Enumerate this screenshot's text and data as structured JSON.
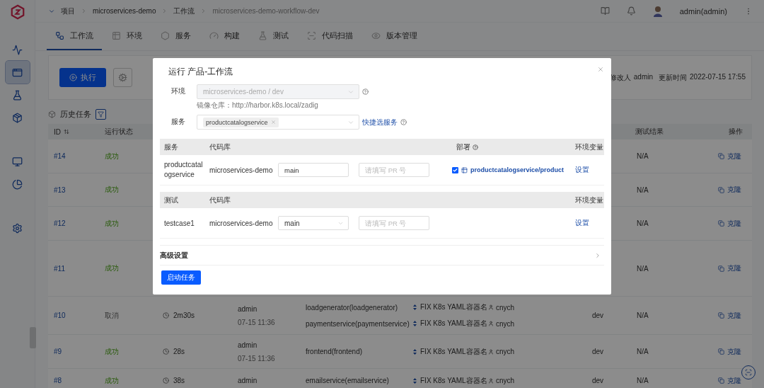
{
  "sidebar": {
    "items": [
      {
        "selected": false
      },
      {
        "selected": true
      },
      {
        "selected": false
      },
      {
        "selected": false
      },
      {
        "selected": false
      },
      {
        "selected": false
      },
      {
        "selected": false
      }
    ]
  },
  "breadcrumb": [
    "项目",
    "microservices-demo",
    "工作流",
    "microservices-demo-workflow-dev"
  ],
  "user": {
    "name": "admin(admin)"
  },
  "tabs": [
    {
      "label": "工作流",
      "selected": true
    },
    {
      "label": "环境",
      "selected": false
    },
    {
      "label": "服务",
      "selected": false
    },
    {
      "label": "构建",
      "selected": false
    },
    {
      "label": "测试",
      "selected": false
    },
    {
      "label": "代码扫描",
      "selected": false
    },
    {
      "label": "版本管理",
      "selected": false
    }
  ],
  "toolbar": {
    "run_button": "执行",
    "modified_by_label": "修改人",
    "modified_by": "admin",
    "updated_label": "更新时间",
    "updated": "2022-07-15 17:55"
  },
  "history": {
    "title": "历史任务"
  },
  "table": {
    "columns": {
      "id": "ID",
      "status": "运行状态",
      "test_result": "测试结果",
      "actions": "操作"
    },
    "rows": [
      {
        "id": "#14",
        "status": "成功",
        "kind": "success",
        "test_result": "N/A",
        "action": "克隆"
      },
      {
        "id": "#13",
        "status": "成功",
        "kind": "success",
        "test_result": "N/A",
        "action": "克隆"
      },
      {
        "id": "#12",
        "status": "成功",
        "kind": "success",
        "test_result": "N/A",
        "action": "克隆"
      },
      {
        "id": "#11",
        "status": "成功",
        "kind": "success",
        "test_result": "N/A",
        "action": "克隆"
      },
      {
        "id": "#10",
        "status": "取消",
        "kind": "cancelled",
        "duration": "2m30s",
        "creator": "admin",
        "time": "07-15 11:36",
        "services": [
          {
            "name": "loadgenerator(loadgenerator)",
            "commit": "FIX K8s YAML容器名",
            "author": "cnych"
          },
          {
            "name": "paymentservice(paymentservice)",
            "commit": "FIX K8s YAML容器名",
            "author": "cnych"
          }
        ],
        "env": "dev",
        "test_result": "N/A",
        "action": "克隆"
      },
      {
        "id": "#9",
        "status": "成功",
        "kind": "success",
        "duration": "28s",
        "creator": "admin",
        "time": "07-15 11:36",
        "services": [
          {
            "name": "frontend(frontend)",
            "commit": "FIX K8s YAML容器名",
            "author": "cnych"
          }
        ],
        "env": "dev",
        "test_result": "N/A",
        "action": "克隆"
      },
      {
        "id": "#8",
        "status": "成功",
        "kind": "success",
        "duration": "38s",
        "creator": "admin",
        "services": [
          {
            "name": "emailservice(emailservice)",
            "commit": "FIX K8s YAML容器名",
            "author": "cnych"
          }
        ],
        "env": "dev",
        "test_result": "N/A",
        "action": "克隆"
      }
    ]
  },
  "modal": {
    "title": "运行 产品-工作流",
    "env": {
      "label": "环境",
      "value": "microservices-demo / dev",
      "disabled": true,
      "hint": "镜像仓库：http://harbor.k8s.local/zadig"
    },
    "service": {
      "label": "服务",
      "tags": [
        "productcatalogservice"
      ],
      "link": "快捷选服务"
    },
    "build_table": {
      "columns": {
        "service": "服务",
        "repo": "代码库",
        "deploy": "部署",
        "env_vars": "环境变量"
      },
      "rows": [
        {
          "service": "productcatalogservice",
          "repo": "microservices-demo",
          "branch": "main",
          "pr_placeholder": "请填写 PR 号",
          "deploy_checked": true,
          "deploy_target": "productcatalogservice/product",
          "env_vars": "设置"
        }
      ]
    },
    "test_table": {
      "columns": {
        "test": "测试",
        "repo": "代码库",
        "env_vars": "环境变量"
      },
      "rows": [
        {
          "test": "testcase1",
          "repo": "microservices-demo",
          "branch": "main",
          "pr_placeholder": "请填写 PR 号",
          "env_vars": "设置"
        }
      ]
    },
    "advanced": {
      "label": "高级设置",
      "expanded": false
    },
    "submit": "启动任务"
  }
}
